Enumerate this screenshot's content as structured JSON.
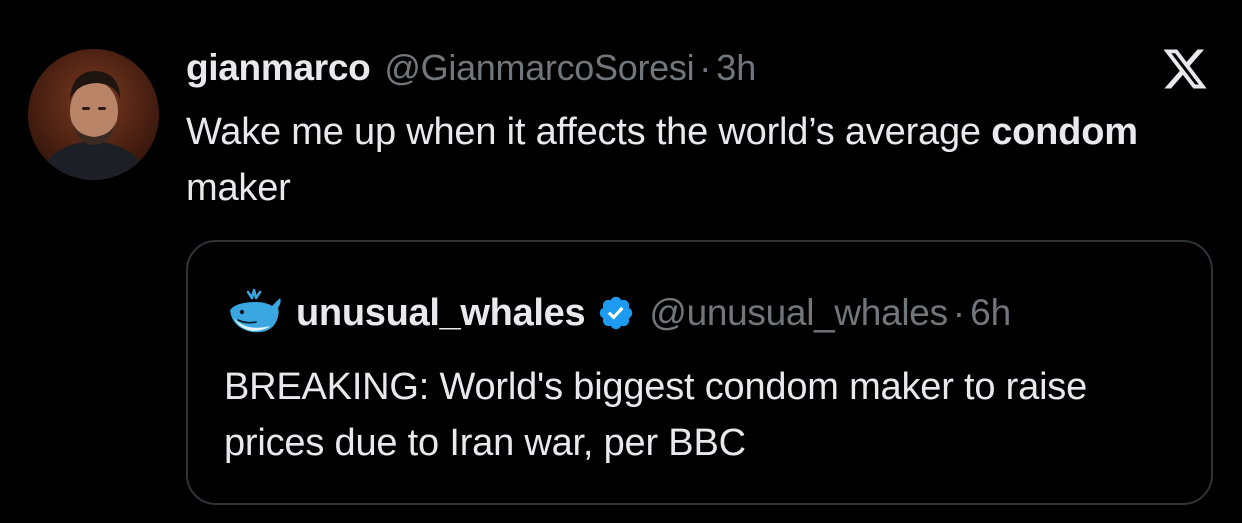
{
  "tweet": {
    "display_name": "gianmarco",
    "handle": "@GianmarcoSoresi",
    "separator": "·",
    "time": "3h",
    "text_part1": "Wake me up when it affects the world’s average ",
    "text_bold": "condom",
    "text_part2": " maker",
    "avatar_icon": "person-avatar"
  },
  "brand": {
    "logo_icon": "x-logo-icon"
  },
  "quoted_tweet": {
    "display_name": "unusual_whales",
    "handle": "@unusual_whales",
    "separator": "·",
    "time": "6h",
    "verified": true,
    "verified_color": "#1d9bf0",
    "avatar_icon": "whale-icon",
    "text": "BREAKING: World's biggest condom maker to raise prices due to Iran war, per BBC"
  },
  "colors": {
    "background": "#000000",
    "primary_text": "#e7e9ea",
    "secondary_text": "#71767b",
    "border": "#2f3336"
  }
}
